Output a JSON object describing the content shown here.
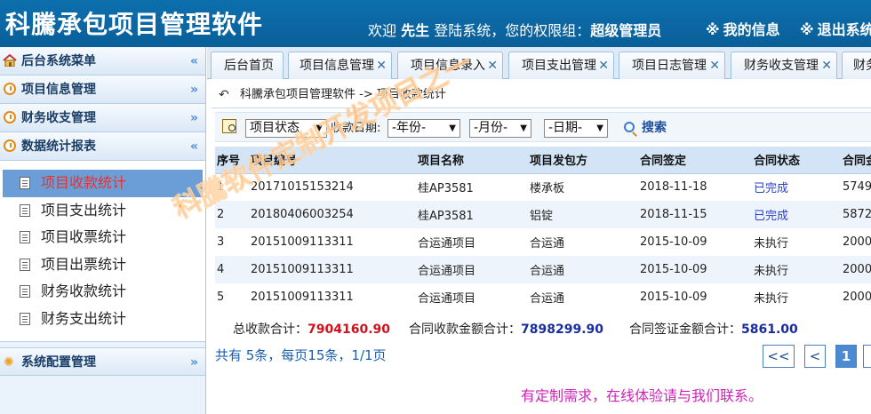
{
  "header": {
    "app_title": "科騰承包项目管理软件",
    "welcome_prefix": "欢迎",
    "user_name": "先生",
    "welcome_mid": "登陆系统，您的权限组：",
    "role": "超级管理员",
    "my_info": "我的信息",
    "logout": "退出系统"
  },
  "sidebar": {
    "menu_title": "后台系统菜单",
    "sections": [
      {
        "label": "项目信息管理"
      },
      {
        "label": "财务收支管理"
      },
      {
        "label": "数据统计报表"
      }
    ],
    "stats_items": [
      "项目收款统计",
      "项目支出统计",
      "项目收票统计",
      "项目出票统计",
      "财务收款统计",
      "财务支出统计"
    ],
    "config_section": "系统配置管理"
  },
  "tabs": [
    {
      "label": "后台首页"
    },
    {
      "label": "项目信息管理"
    },
    {
      "label": "项目信息录入"
    },
    {
      "label": "项目支出管理"
    },
    {
      "label": "项目日志管理"
    },
    {
      "label": "财务收支管理"
    },
    {
      "label": "财务"
    }
  ],
  "breadcrumb": "科騰承包项目管理软件 -> 项目收款统计",
  "filters": {
    "status_select": "项目状态",
    "date_label": "收款日期:",
    "year_select": "-年份-",
    "month_select": "-月份-",
    "day_select": "-日期-",
    "search_label": "搜索"
  },
  "table": {
    "headers": [
      "序号",
      "项目编号",
      "项目名称",
      "项目发包方",
      "合同签定",
      "合同状态",
      "合同金"
    ],
    "rows": [
      [
        "1",
        "20171015153214",
        "桂AP3581",
        "楼承板",
        "2018-11-18",
        "已完成",
        "5749"
      ],
      [
        "2",
        "20180406003254",
        "桂AP3581",
        "铝锭",
        "2018-11-15",
        "已完成",
        "5872"
      ],
      [
        "3",
        "20151009113311",
        "合运通项目",
        "合运通",
        "2015-10-09",
        "未执行",
        "2000"
      ],
      [
        "4",
        "20151009113311",
        "合运通项目",
        "合运通",
        "2015-10-09",
        "未执行",
        "2000"
      ],
      [
        "5",
        "20151009113311",
        "合运通项目",
        "合运通",
        "2015-10-09",
        "未执行",
        "2000"
      ]
    ]
  },
  "totals": {
    "received_label": "总收款合计：",
    "received_value": "7904160.90",
    "contract_received_label": "合同收款金额合计：",
    "contract_received_value": "7898299.90",
    "deposit_label": "合同签证金额合计：",
    "deposit_value": "5861.00"
  },
  "summary": "共有 5条，每页15条，1/1页",
  "pager": {
    "first": "<<",
    "prev": "<",
    "current": "1"
  },
  "contact": "有定制需求，在线体验请与我们联系。",
  "watermark": "科騰软件定制开发项目之一",
  "colors": {
    "header_bg": "#0d6fae",
    "active_menu": "#6b9ed6",
    "red_total": "#d3111d",
    "watermark": "#ff7a0c"
  }
}
